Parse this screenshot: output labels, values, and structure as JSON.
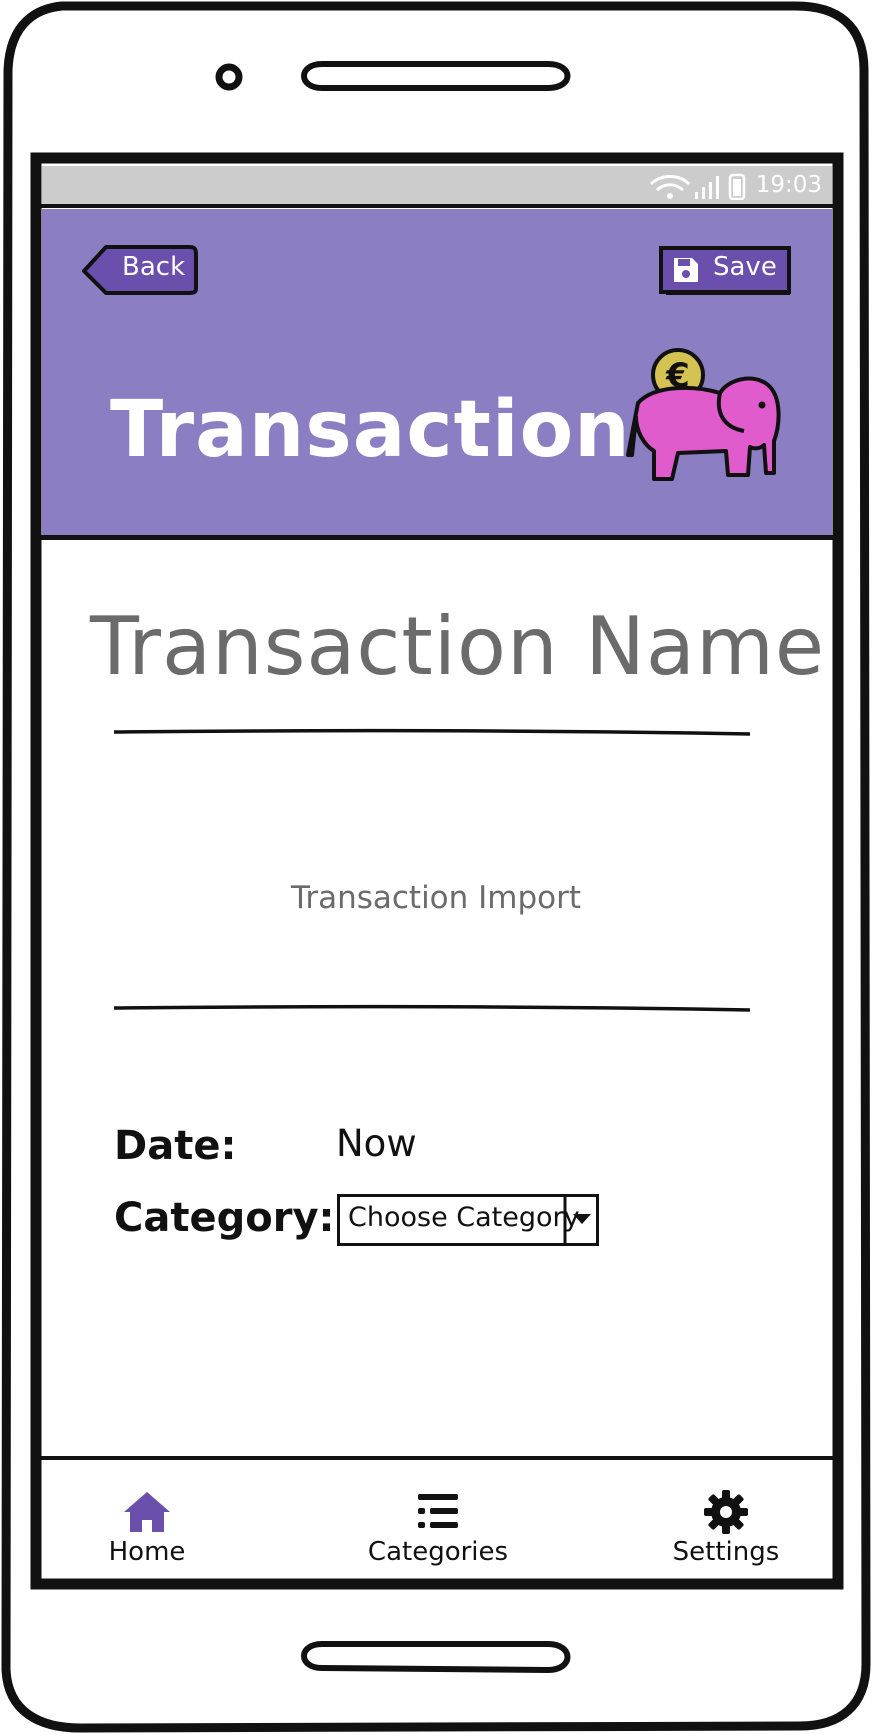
{
  "status_bar": {
    "time": "19:03",
    "icons": [
      "wifi-icon",
      "signal-icon",
      "battery-icon"
    ]
  },
  "header": {
    "back_label": "Back",
    "save_label": "Save",
    "title": "Transaction",
    "mascot_icon": "piggy-bank-elephant-euro-icon",
    "background_color": "#8b7ec3",
    "button_color": "#6b4fad"
  },
  "form": {
    "name_placeholder": "Transaction Name",
    "import_text": "Transaction Import",
    "date_label": "Date:",
    "date_value": "Now",
    "category_label": "Category:",
    "category_selected": "Choose Category"
  },
  "bottom_nav": {
    "items": [
      {
        "label": "Home",
        "icon": "home-icon",
        "active": true
      },
      {
        "label": "Categories",
        "icon": "list-icon",
        "active": false
      },
      {
        "label": "Settings",
        "icon": "gear-icon",
        "active": false
      }
    ],
    "active_color": "#6b4fad"
  }
}
